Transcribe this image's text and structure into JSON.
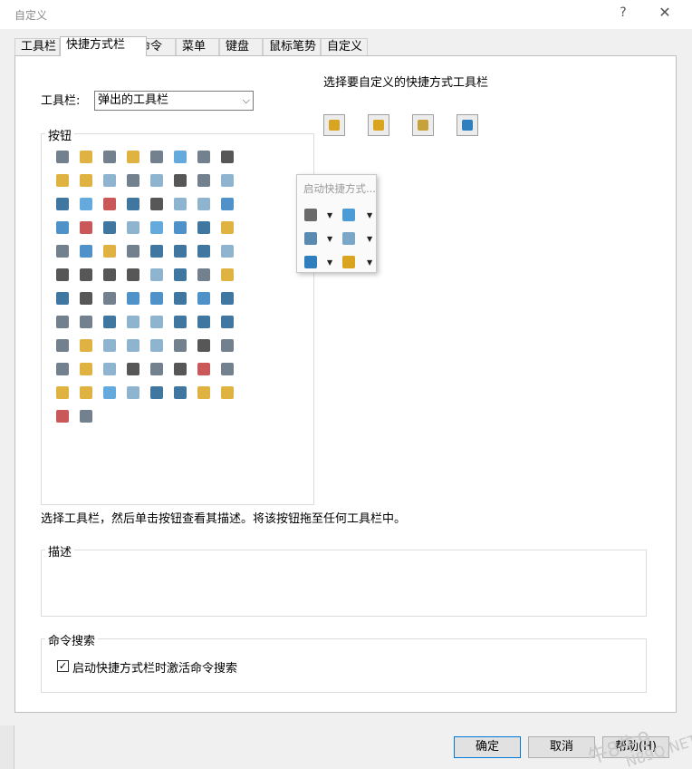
{
  "window": {
    "title": "自定义",
    "help_label": "?",
    "close_label": "✕"
  },
  "tabs": [
    {
      "label": "工具栏"
    },
    {
      "label": "快捷方式栏",
      "active": true
    },
    {
      "label": "命令"
    },
    {
      "label": "菜单"
    },
    {
      "label": "键盘"
    },
    {
      "label": "鼠标笔势"
    },
    {
      "label": "自定义"
    }
  ],
  "toolbar_selector": {
    "label": "工具栏:",
    "value": "弹出的工具栏",
    "arrow": "⌵"
  },
  "buttons_group": {
    "label": "按钮"
  },
  "shortcut_area": {
    "title": "选择要自定义的快捷方式工具栏",
    "buttons": [
      {
        "icon": "part-shortcut-icon",
        "color": "#d9a520"
      },
      {
        "icon": "assembly-shortcut-icon",
        "color": "#d9a520"
      },
      {
        "icon": "drawing-shortcut-icon",
        "color": "#c7a13a"
      },
      {
        "icon": "sketch-shortcut-icon",
        "color": "#2f7fbf"
      }
    ]
  },
  "popup": {
    "title": "启动快捷方式...",
    "items": [
      {
        "icon": "select-arrow-icon",
        "color": "#6a6a6a"
      },
      {
        "icon": "view-orientation-icon",
        "color": "#4a9bd6"
      },
      {
        "icon": "display-style-icon",
        "color": "#5a8ab0"
      },
      {
        "icon": "shaded-view-icon",
        "color": "#7aa7c7"
      },
      {
        "icon": "section-view-icon",
        "color": "#2f7fbf"
      },
      {
        "icon": "appearance-icon",
        "color": "#d9a520"
      }
    ]
  },
  "instruction": "选择工具栏，然后单击按钮查看其描述。将该按钮拖至任何工具栏中。",
  "description_group": {
    "label": "描述",
    "text": ""
  },
  "command_search": {
    "label": "命令搜索",
    "checkbox_label": "启动快捷方式栏时激活命令搜索",
    "checked": true,
    "check_mark": "✓"
  },
  "footer": {
    "ok": "确定",
    "cancel": "取消",
    "help": "帮助(H)"
  },
  "watermark": {
    "text1": "牛8牛9",
    "text2": "N89Q.NET"
  }
}
